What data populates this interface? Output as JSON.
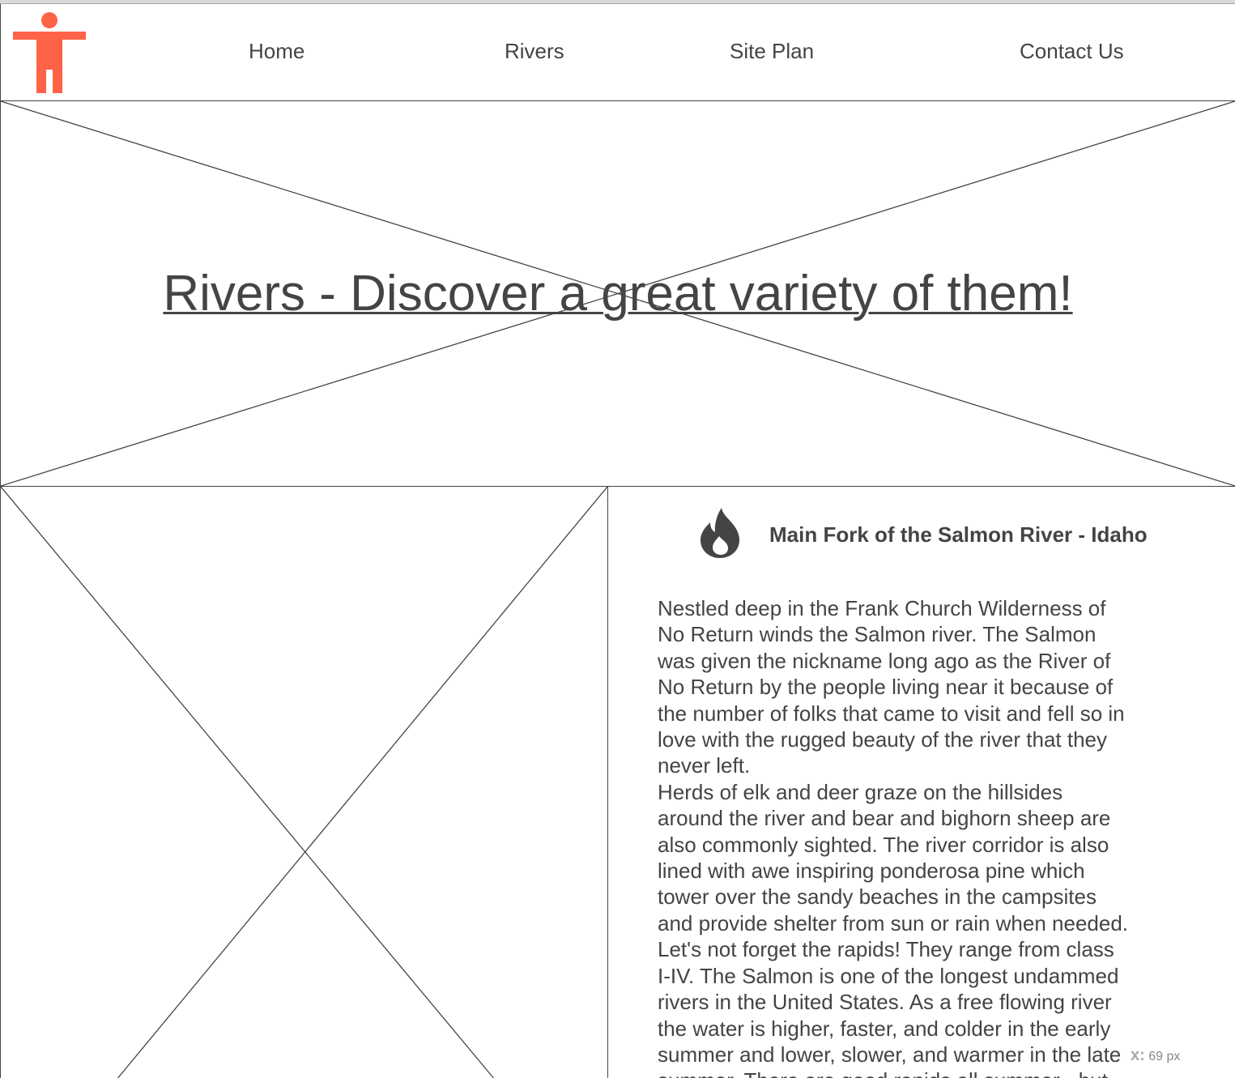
{
  "nav": {
    "items": [
      {
        "label": "Home"
      },
      {
        "label": "Rivers"
      },
      {
        "label": "Site Plan"
      },
      {
        "label": "Contact Us"
      }
    ]
  },
  "logo": {
    "icon": "person-icon",
    "color": "#FF6347"
  },
  "hero": {
    "title": "Rivers - Discover a great variety of them!",
    "background": "image-placeholder"
  },
  "article": {
    "icon": "fire-icon",
    "title": "Main Fork of the Salmon River - Idaho",
    "paragraphs": [
      "Nestled deep in the Frank Church Wilderness of\nNo Return winds the Salmon river. The Salmon\nwas given the nickname long ago as the River of\nNo Return by the people living near it because of\nthe number of folks that came to visit and fell so in\nlove with the rugged beauty of the river that they\nnever left.",
      "Herds of elk and deer graze on the hillsides\naround the river and bear and bighorn sheep are\nalso commonly sighted. The river corridor is also\nlined with awe inspiring ponderosa pine which\ntower over the sandy beaches in the campsites\nand provide shelter from sun or rain when needed.\nLet's not forget the rapids! They range from class\nI-IV. The Salmon is one of the longest undammed\nrivers in the United States. As a free flowing river\nthe water is higher, faster, and colder in the early\nsummer and lower, slower, and warmer in the late\nsummer. There are good rapids all summer - but"
    ]
  },
  "readout": {
    "mark": "x:",
    "value": "69 px"
  },
  "colors": {
    "text": "#444444",
    "accent": "#FF6347",
    "border": "#444444"
  }
}
